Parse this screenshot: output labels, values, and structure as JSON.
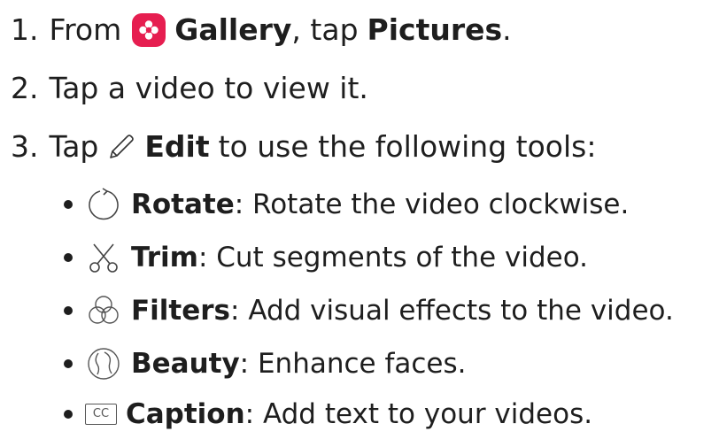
{
  "steps": [
    {
      "number": "1.",
      "prefix": "From",
      "app_name": "Gallery",
      "middle": ", tap",
      "target": "Pictures",
      "suffix": ".",
      "icon": "gallery-icon"
    },
    {
      "number": "2.",
      "text": "Tap a video to view it."
    },
    {
      "number": "3.",
      "prefix": "Tap",
      "action": "Edit",
      "suffix": "to use the following tools:",
      "icon": "pencil-icon"
    }
  ],
  "tools": [
    {
      "name": "Rotate",
      "description": ": Rotate the video clockwise.",
      "icon": "rotate-icon"
    },
    {
      "name": "Trim",
      "description": ": Cut segments of the video.",
      "icon": "scissors-icon"
    },
    {
      "name": "Filters",
      "description": ": Add visual effects to the video.",
      "icon": "filters-icon"
    },
    {
      "name": "Beauty",
      "description": ": Enhance faces.",
      "icon": "beauty-icon"
    },
    {
      "name": "Caption",
      "description": ": Add text to your videos.",
      "icon": "caption-icon",
      "icon_text": "CC"
    }
  ],
  "colors": {
    "gallery_accent": "#e61e50",
    "text": "#1e1e1e"
  }
}
